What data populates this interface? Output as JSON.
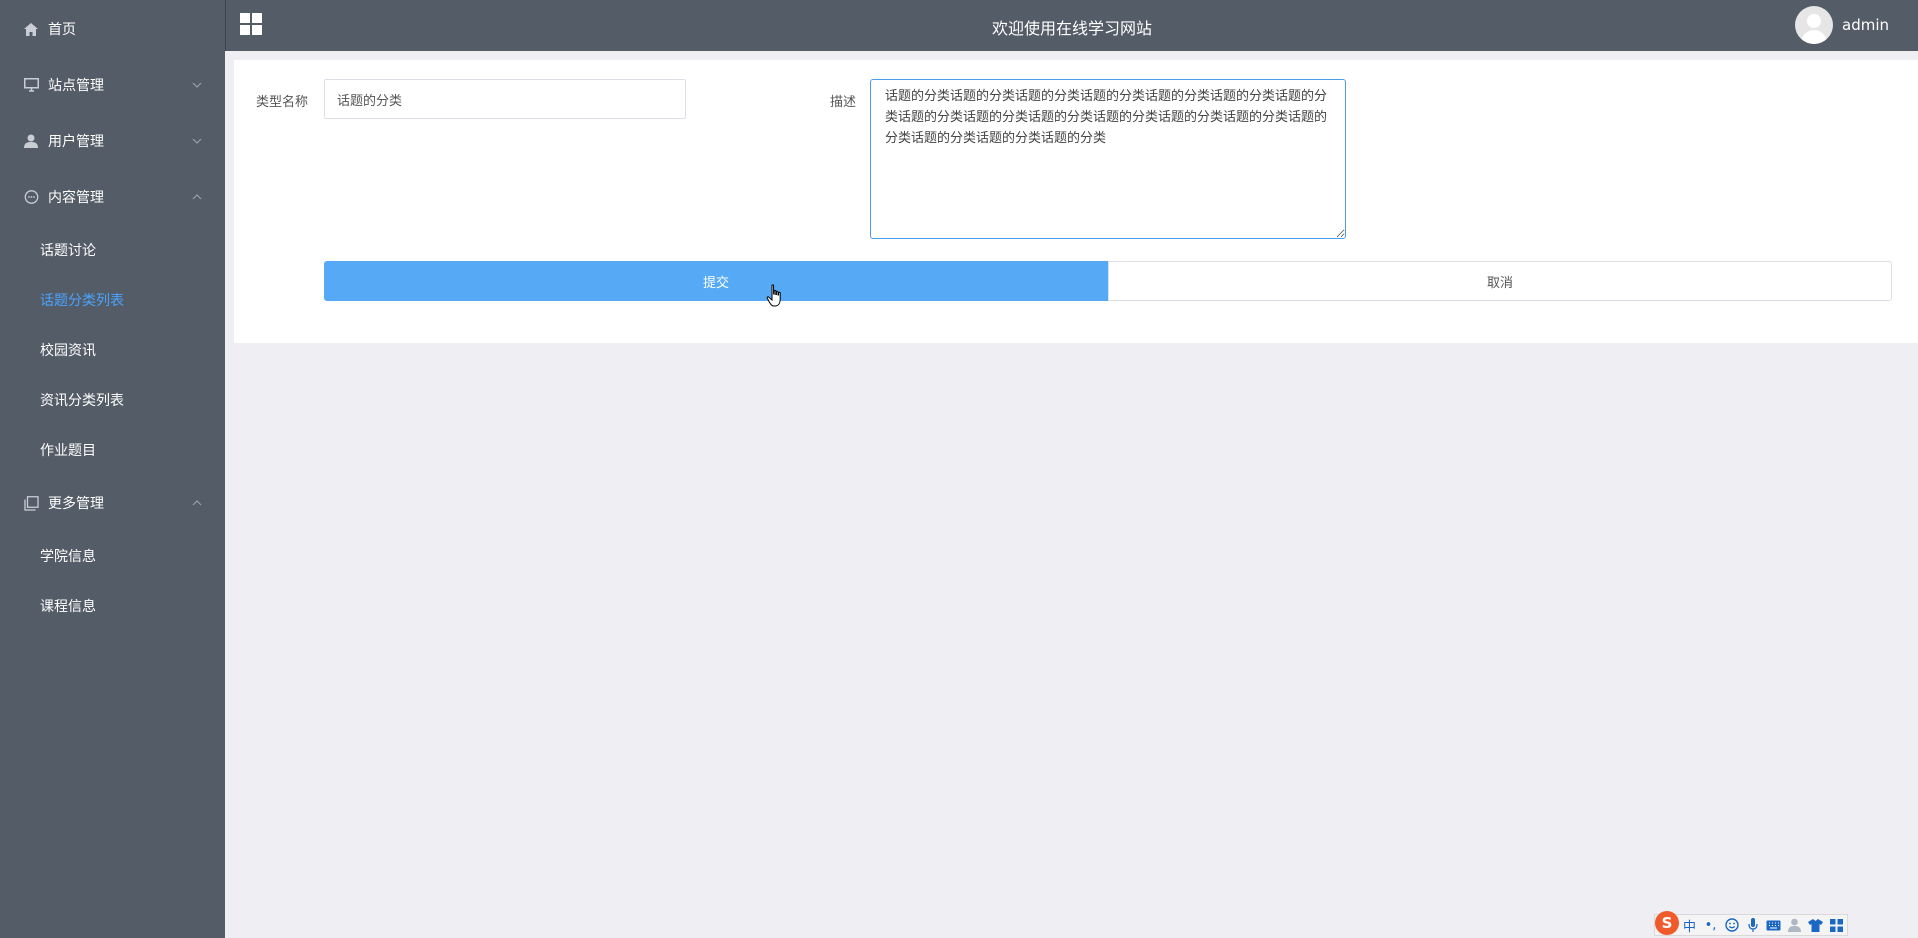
{
  "sidebar": {
    "home": "首页",
    "site_mgmt": "站点管理",
    "user_mgmt": "用户管理",
    "content_mgmt": "内容管理",
    "content_items": [
      "话题讨论",
      "话题分类列表",
      "校园资讯",
      "资讯分类列表",
      "作业题目"
    ],
    "more_mgmt": "更多管理",
    "more_items": [
      "学院信息",
      "课程信息"
    ],
    "active_item": "话题分类列表",
    "active_color": "#4aa3ff"
  },
  "header": {
    "title": "欢迎使用在线学习网站",
    "username": "admin"
  },
  "form": {
    "type_name_label": "类型名称",
    "type_name_value": "话题的分类",
    "description_label": "描述",
    "description_value": "话题的分类话题的分类话题的分类话题的分类话题的分类话题的分类话题的分类话题的分类话题的分类话题的分类话题的分类话题的分类话题的分类话题的分类话题的分类话题的分类话题的分类",
    "submit_label": "提交",
    "cancel_label": "取消",
    "submit_color": "#56aaf5"
  },
  "ime": {
    "logo": "S",
    "mode": "中",
    "punct": "•,",
    "icons": [
      "smile-icon",
      "mic-icon",
      "keyboard-icon",
      "user-icon",
      "shirt-icon",
      "grid-icon"
    ]
  }
}
